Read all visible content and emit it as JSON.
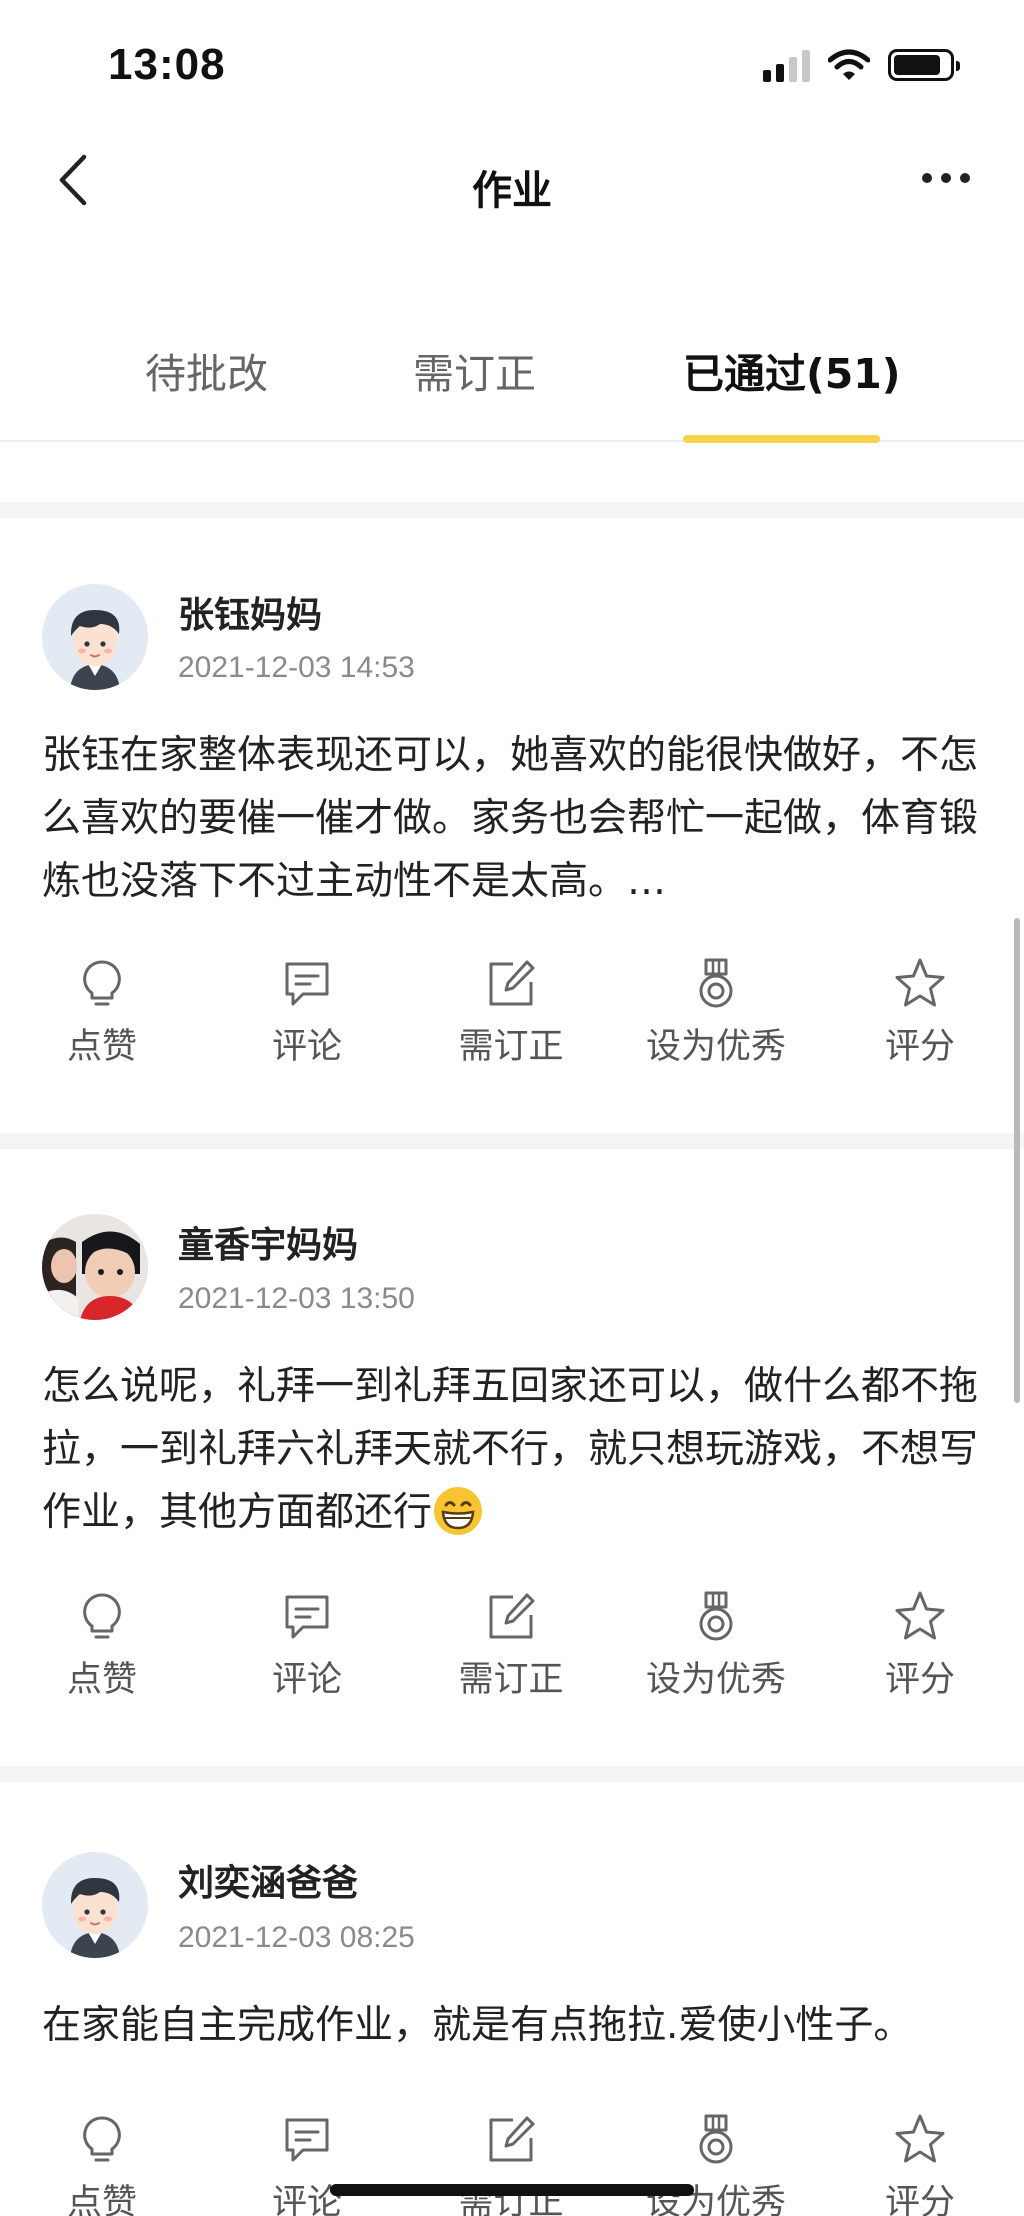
{
  "status_bar": {
    "time": "13:08"
  },
  "nav": {
    "title": "作业"
  },
  "tabs": [
    {
      "label": "待批改"
    },
    {
      "label": "需订正"
    },
    {
      "label": "已通过(51)"
    }
  ],
  "action_labels": {
    "like": "点赞",
    "comment": "评论",
    "needs_correction": "需订正",
    "mark_excellent": "设为优秀",
    "rate": "评分"
  },
  "posts": [
    {
      "author": "张钰妈妈",
      "datetime": "2021-12-03 14:53",
      "content": "张钰在家整体表现还可以，她喜欢的能很快做好，不怎么喜欢的要催一催才做。家务也会帮忙一起做，体育锻炼也没落下不过主动性不是太高。…"
    },
    {
      "author": "童香宇妈妈",
      "datetime": "2021-12-03 13:50",
      "content": "怎么说呢，礼拜一到礼拜五回家还可以，做什么都不拖拉，一到礼拜六礼拜天就不行，就只想玩游戏，不想写作业，其他方面都还行"
    },
    {
      "author": "刘奕涵爸爸",
      "datetime": "2021-12-03 08:25",
      "content": "在家能自主完成作业，就是有点拖拉.爱使小性子。"
    }
  ]
}
